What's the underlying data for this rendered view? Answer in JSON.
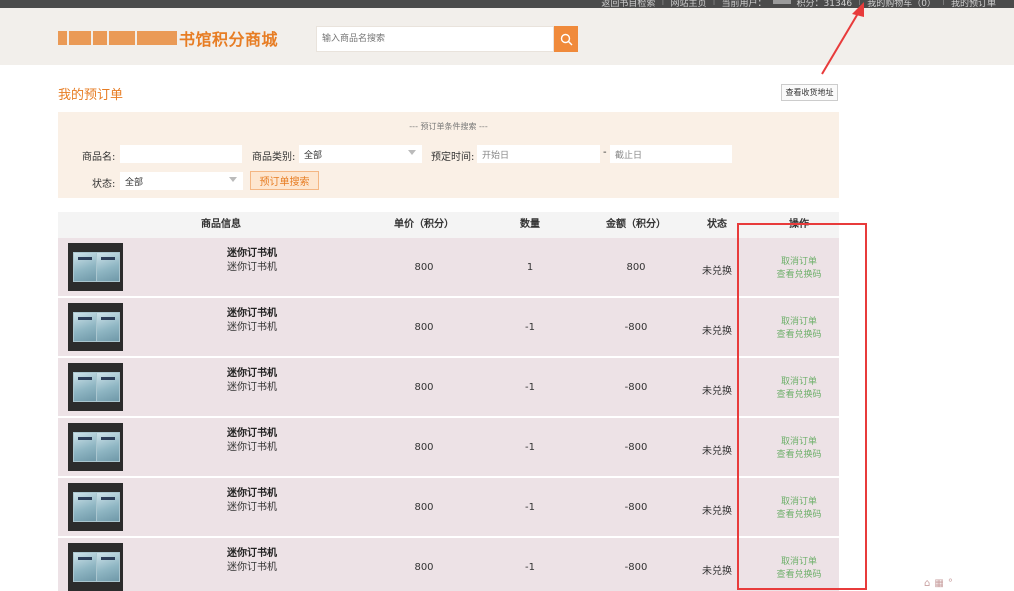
{
  "top_nav": {
    "links": [
      "返回书目检索",
      "网站主页",
      "当前用户：",
      "积分：31346",
      "我的购物车（0）",
      "我的预订单"
    ],
    "user_name_blurred": "■"
  },
  "header": {
    "logo_text": "书馆积分商城",
    "search_placeholder": "输入商品名搜索"
  },
  "page": {
    "title": "我的预订单",
    "view_address_label": "查看收货地址"
  },
  "filter": {
    "title": "--- 预订单条件搜索 ---",
    "product_name_label": "商品名:",
    "product_name_value": "",
    "category_label": "商品类别:",
    "category_value": "全部",
    "date_label": "预定时间:",
    "start_placeholder": "开始日",
    "date_sep": "-",
    "end_placeholder": "截止日",
    "status_label": "状态:",
    "status_value": "全部",
    "search_button": "预订单搜索"
  },
  "table": {
    "headers": [
      "商品信息",
      "单价（积分）",
      "数量",
      "金额（积分）",
      "状态",
      "操作"
    ],
    "rows": [
      {
        "name": "迷你订书机",
        "desc": "迷你订书机",
        "price": "800",
        "qty": "1",
        "amount": "800",
        "status": "未兑换",
        "op1": "取消订单",
        "op2": "查看兑换码"
      },
      {
        "name": "迷你订书机",
        "desc": "迷你订书机",
        "price": "800",
        "qty": "-1",
        "amount": "-800",
        "status": "未兑换",
        "op1": "取消订单",
        "op2": "查看兑换码"
      },
      {
        "name": "迷你订书机",
        "desc": "迷你订书机",
        "price": "800",
        "qty": "-1",
        "amount": "-800",
        "status": "未兑换",
        "op1": "取消订单",
        "op2": "查看兑换码"
      },
      {
        "name": "迷你订书机",
        "desc": "迷你订书机",
        "price": "800",
        "qty": "-1",
        "amount": "-800",
        "status": "未兑换",
        "op1": "取消订单",
        "op2": "查看兑换码"
      },
      {
        "name": "迷你订书机",
        "desc": "迷你订书机",
        "price": "800",
        "qty": "-1",
        "amount": "-800",
        "status": "未兑换",
        "op1": "取消订单",
        "op2": "查看兑换码"
      },
      {
        "name": "迷你订书机",
        "desc": "迷你订书机",
        "price": "800",
        "qty": "-1",
        "amount": "-800",
        "status": "未兑换",
        "op1": "取消订单",
        "op2": "查看兑换码"
      }
    ]
  },
  "colors": {
    "accent": "#e77d24",
    "annotation": "#e83b3b",
    "op_link": "#6fb06b",
    "row_bg": "#ede2e6"
  },
  "icons": [
    "search-icon",
    "chevron-down-icon",
    "product-thumbnail"
  ]
}
